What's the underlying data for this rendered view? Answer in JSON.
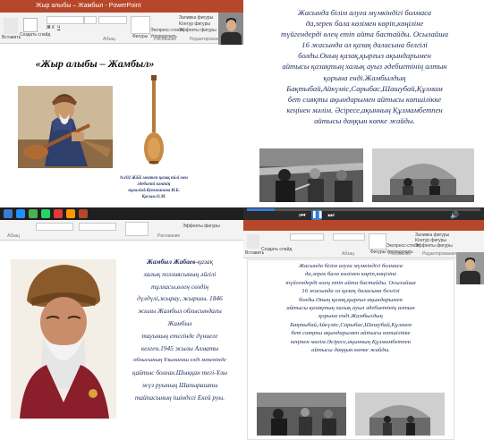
{
  "q1": {
    "window_title": "Жыр алыбы – Жамбыл - PowerPoint",
    "ribbon": {
      "paste_label": "Вставить",
      "new_slide_label": "Создать слайд",
      "shapes_label": "Фигуры",
      "arrange_label": "Упорядочить",
      "quick_styles_label": "Экспресс-стили",
      "shape_fill_label": "Заливка фигуры",
      "shape_outline_label": "Контур фигуры",
      "shape_effects_label": "Эффекты фигуры",
      "paragraph_group": "Абзац",
      "drawing_group": "Рисование",
      "editing_group": "Редактирование"
    },
    "slide": {
      "title": "«Жыр алыбы – Жамбыл»",
      "caption_line1": "№102 ЖББ мектеп қазақ тілі мен",
      "caption_line2": "әдебиеті пәнінің",
      "caption_line3": "мұғалімі:Кутжанова И.Б.",
      "caption_line4": "Қасым.О.М."
    },
    "bottom_ribbon": {
      "paragraph_group": "Абзац",
      "drawing_group": "Рисование",
      "shape_effects_label": "Эффекты фигуры"
    },
    "taskbar_icon_colors": [
      "#1e90ff",
      "#4caf50",
      "#25d366",
      "#e53935",
      "#ff9800",
      "#b7472a"
    ]
  },
  "q2": {
    "slide_text": [
      "Жасында білім алуға мүмкіндігі болмаса",
      "да,зерек бала көзімен көріп,көңіліне",
      "түйгендерді өлең етіп айта бастайды. Осылайша",
      "16 жасында ол қазақ даласына белгілі",
      "болды.Оның қазақ,қырғыз ақындарымен",
      "айтысы қазақтың халық ауыз әдебиетінің алтын",
      "қорына енді.Жамбылдың",
      "Бақтыбай,Айкүміс,Сарыбас,Шашубай,Құлмам",
      "бет сияқты ақындарымен айтысы көпшілікке",
      "кеңінен мәлім. Әсіресе,ақынның Құлмамбетпен",
      "айтысы даңқын көпке жайды."
    ],
    "video_progress": 0.12
  },
  "q3": {
    "ribbon": {
      "paragraph_group": "Абзац",
      "drawing_group": "Рисование",
      "shape_effects_label": "Эффекты фигуры"
    },
    "slide": {
      "name_bold": "Жамбыл Жабаев",
      "lines": [
        "-қазақ",
        "халық поэзиясының әйгілі",
        "тұлғасы,өлең сөздің",
        "дүлдүлі,жырау, жыршы. 1846",
        "жылы Жамбыл облысындағы",
        "Жамбыл",
        "тауының етегінде дүниеге",
        "келген.1945 жылы Алматы",
        "облысының Ұзынағаш елді мекенінде",
        "қайтыс болған.Шыққан тегі-Ұлы",
        "жүз руының Шапырашты",
        "тайпасының ішіндегі Екей руы."
      ]
    }
  },
  "q4": {
    "ribbon": {
      "paste_label": "Вставить",
      "new_slide_label": "Создать слайд",
      "shapes_label": "Фигуры",
      "arrange_label": "Упорядочить",
      "quick_styles_label": "Экспресс-стили",
      "shape_fill_label": "Заливка фигуры",
      "shape_outline_label": "Контур фигуры",
      "shape_effects_label": "Эффекты фигуры",
      "paragraph_group": "Абзац",
      "drawing_group": "Рисование",
      "editing_group": "Редактирование"
    },
    "slide_text": [
      "Жасында білім алуға мүмкіндігі болмаса",
      "да,зерек бала көзімен көріп,көңіліне",
      "түйгендерді өлең етіп айта бастайды. Осылайша",
      "16 жасында ол қазақ даласына белгілі",
      "болды.Оның қазақ,қырғыз ақындарымен",
      "айтысы қазақтың халық ауыз әдебиетінің алтын",
      "қорына енді.Жамбылдың",
      "Бақтыбай,Айкүміс,Сарыбас,Шашубай,Құлмам",
      "бет сияқты ақындарымен айтысы көпшілікке",
      "кеңінен мәлім.Әсіресе,ақынның Құлмамбетпен",
      "айтысы даңқын көпке жайды."
    ]
  }
}
